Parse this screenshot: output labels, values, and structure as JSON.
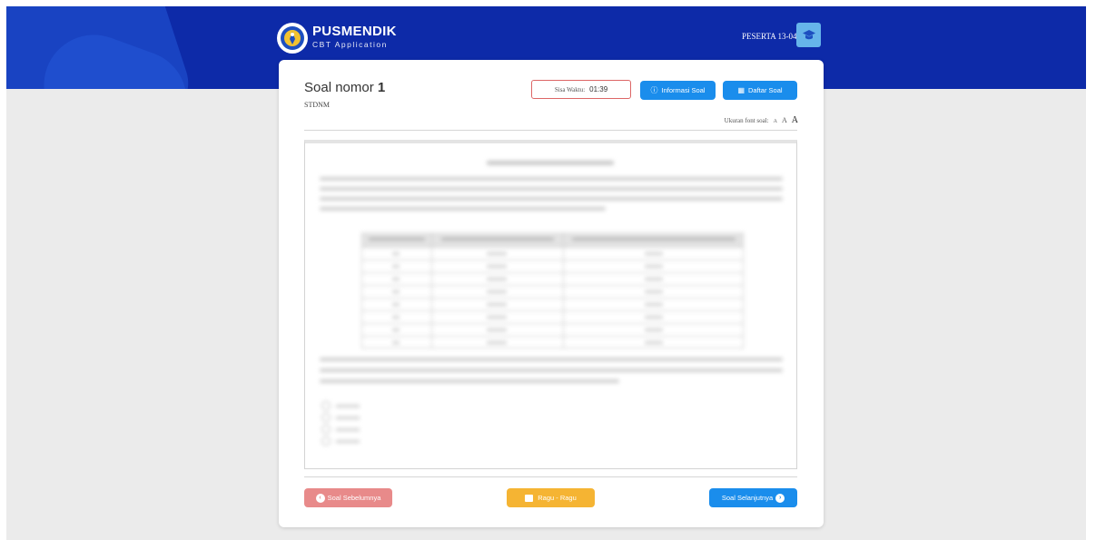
{
  "app": {
    "name": "PUSMENDIK",
    "subtitle": "CBT Application",
    "user_label": "PESERTA 13-04",
    "icons": {
      "logo": "tut-wuri-handayani-logo",
      "avatar": "graduation-cap-icon"
    }
  },
  "question": {
    "title_prefix": "Soal nomor",
    "number": "1",
    "code": "STDNM",
    "timer_label": "Sisa Waktu:",
    "timer_value": "01:39",
    "font_size_label": "Ukuran font soal:",
    "font_sizes": [
      "A",
      "A",
      "A"
    ]
  },
  "buttons": {
    "info": "Informasi Soal",
    "list": "Daftar Soal",
    "prev": "Soal Sebelumnya",
    "doubt": "Ragu - Ragu",
    "next": "Soal Selanjutnya"
  },
  "colors": {
    "header": "#0d2aa8",
    "primary": "#1a8dec",
    "prev_button": "#e88a8a",
    "doubt_button": "#f5b433",
    "timer_border": "#dd6666"
  }
}
